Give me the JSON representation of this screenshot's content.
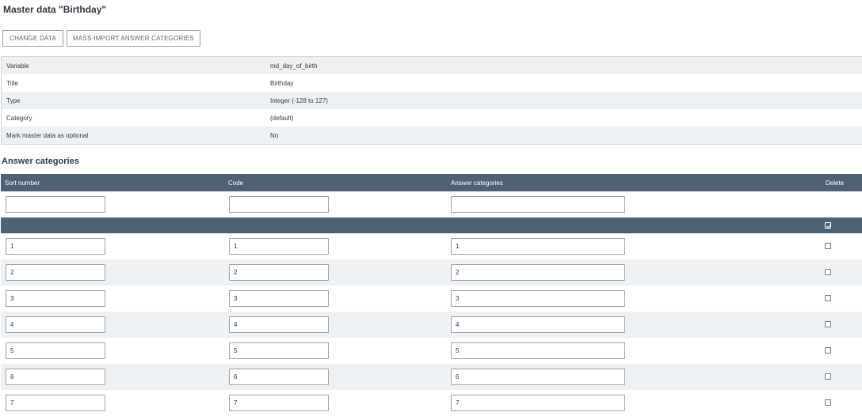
{
  "page": {
    "title": "Master data \"Birthday\""
  },
  "toolbar": {
    "change_label": "CHANGE DATA",
    "import_label": "MASS-IMPORT ANSWER CATEGORIES"
  },
  "properties": [
    {
      "label": "Variable",
      "value": "md_day_of_birth"
    },
    {
      "label": "Title",
      "value": "Birthday"
    },
    {
      "label": "Type",
      "value": "Integer (-128 to 127)"
    },
    {
      "label": "Category",
      "value": "(default)"
    },
    {
      "label": "Mark master data as optional",
      "value": "No"
    }
  ],
  "answers": {
    "title": "Answer categories",
    "columns": {
      "sort": "Sort number",
      "code": "Code",
      "answer": "Answer categories",
      "delete": "Delete"
    },
    "filters": {
      "sort": "",
      "code": "",
      "answer": ""
    },
    "rows": [
      {
        "sort": "1",
        "code": "1",
        "answer": "1",
        "delete": false
      },
      {
        "sort": "2",
        "code": "2",
        "answer": "2",
        "delete": false
      },
      {
        "sort": "3",
        "code": "3",
        "answer": "3",
        "delete": false
      },
      {
        "sort": "4",
        "code": "4",
        "answer": "4",
        "delete": false
      },
      {
        "sort": "5",
        "code": "5",
        "answer": "5",
        "delete": false
      },
      {
        "sort": "6",
        "code": "6",
        "answer": "6",
        "delete": false
      },
      {
        "sort": "7",
        "code": "7",
        "answer": "7",
        "delete": false
      }
    ]
  },
  "colors": {
    "header_bg": "#4f6275",
    "row_alt": "#eef1f4",
    "text": "#2f3b47"
  },
  "icons": {
    "select_all": "select-all-checkbox-icon"
  }
}
